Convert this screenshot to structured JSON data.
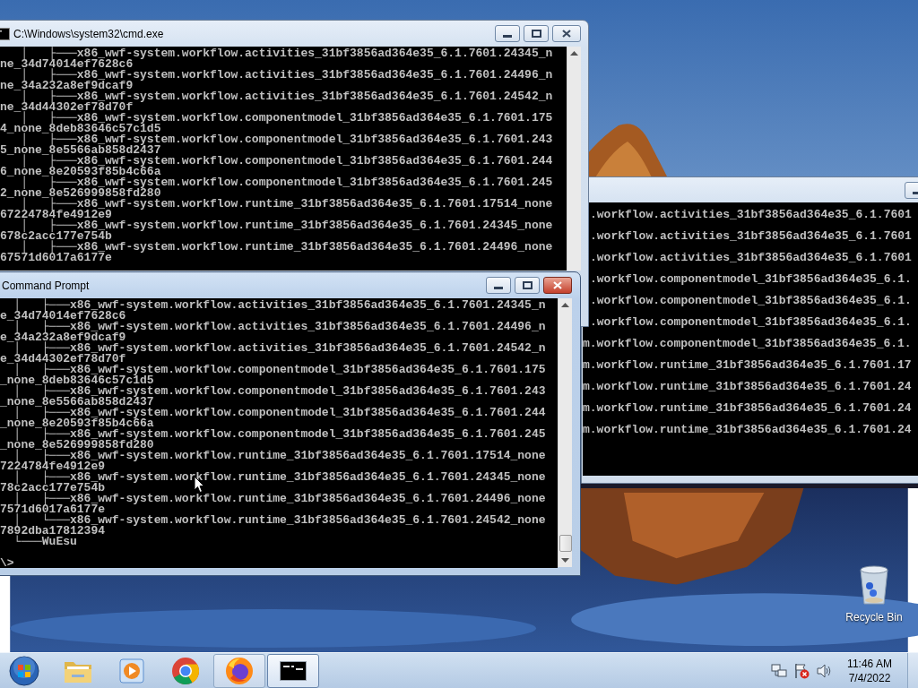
{
  "windows": [
    {
      "title": "C:\\Windows\\system32\\cmd.exe",
      "active": false,
      "lines": [
        "   │   ├───x86_wwf-system.workflow.activities_31bf3856ad364e35_6.1.7601.24345_n",
        "ne_34d74014ef7628c6",
        "   │   ├───x86_wwf-system.workflow.activities_31bf3856ad364e35_6.1.7601.24496_n",
        "ne_34a232a8ef9dcaf9",
        "   │   ├───x86_wwf-system.workflow.activities_31bf3856ad364e35_6.1.7601.24542_n",
        "ne_34d44302ef78d70f",
        "   │   ├───x86_wwf-system.workflow.componentmodel_31bf3856ad364e35_6.1.7601.175",
        "4_none_8deb83646c57c1d5",
        "   │   ├───x86_wwf-system.workflow.componentmodel_31bf3856ad364e35_6.1.7601.243",
        "5_none_8e5566ab858d2437",
        "   │   ├───x86_wwf-system.workflow.componentmodel_31bf3856ad364e35_6.1.7601.244",
        "6_none_8e20593f85b4c66a",
        "   │   ├───x86_wwf-system.workflow.componentmodel_31bf3856ad364e35_6.1.7601.245",
        "2_none_8e526999858fd280",
        "   │   ├───x86_wwf-system.workflow.runtime_31bf3856ad364e35_6.1.7601.17514_none",
        "67224784fe4912e9",
        "   │   ├───x86_wwf-system.workflow.runtime_31bf3856ad364e35_6.1.7601.24345_none",
        "678c2acc177e754b",
        "   │   ├───x86_wwf-system.workflow.runtime_31bf3856ad364e35_6.1.7601.24496_none",
        "67571d6017a6177e"
      ]
    },
    {
      "active": false,
      "lines": [
        ".workflow.activities_31bf3856ad364e35_6.1.7601",
        ".workflow.activities_31bf3856ad364e35_6.1.7601",
        ".workflow.activities_31bf3856ad364e35_6.1.7601",
        ".workflow.componentmodel_31bf3856ad364e35_6.1.",
        ".workflow.componentmodel_31bf3856ad364e35_6.1.",
        ".workflow.componentmodel_31bf3856ad364e35_6.1.",
        "m.workflow.componentmodel_31bf3856ad364e35_6.1.",
        "m.workflow.runtime_31bf3856ad364e35_6.1.7601.17",
        "m.workflow.runtime_31bf3856ad364e35_6.1.7601.24",
        "m.workflow.runtime_31bf3856ad364e35_6.1.7601.24",
        "m.workflow.runtime_31bf3856ad364e35_6.1.7601.24"
      ]
    },
    {
      "title": "Command Prompt",
      "active": true,
      "lines": [
        "  │   ├───x86_wwf-system.workflow.activities_31bf3856ad364e35_6.1.7601.24345_n",
        "e_34d74014ef7628c6",
        "  │   ├───x86_wwf-system.workflow.activities_31bf3856ad364e35_6.1.7601.24496_n",
        "e_34a232a8ef9dcaf9",
        "  │   ├───x86_wwf-system.workflow.activities_31bf3856ad364e35_6.1.7601.24542_n",
        "e_34d44302ef78d70f",
        "  │   ├───x86_wwf-system.workflow.componentmodel_31bf3856ad364e35_6.1.7601.175",
        "_none_8deb83646c57c1d5",
        "  │   ├───x86_wwf-system.workflow.componentmodel_31bf3856ad364e35_6.1.7601.243",
        "_none_8e5566ab858d2437",
        "  │   ├───x86_wwf-system.workflow.componentmodel_31bf3856ad364e35_6.1.7601.244",
        "_none_8e20593f85b4c66a",
        "  │   ├───x86_wwf-system.workflow.componentmodel_31bf3856ad364e35_6.1.7601.245",
        "_none_8e526999858fd280",
        "  │   ├───x86_wwf-system.workflow.runtime_31bf3856ad364e35_6.1.7601.17514_none",
        "7224784fe4912e9",
        "  │   ├───x86_wwf-system.workflow.runtime_31bf3856ad364e35_6.1.7601.24345_none",
        "78c2acc177e754b",
        "  │   ├───x86_wwf-system.workflow.runtime_31bf3856ad364e35_6.1.7601.24496_none",
        "7571d6017a6177e",
        "  │   └───x86_wwf-system.workflow.runtime_31bf3856ad364e35_6.1.7601.24542_none",
        "7892dba17812394",
        "  └───WuEsu"
      ],
      "prompt": "\\>"
    }
  ],
  "desktop": {
    "kind": "picture",
    "icons": [
      {
        "label": "Recycle Bin"
      }
    ]
  },
  "taskbar": {
    "items": [
      {
        "kind": "folder",
        "open": false,
        "selected": false
      },
      {
        "kind": "media",
        "open": false,
        "selected": false
      },
      {
        "kind": "chrome",
        "open": false,
        "selected": false
      },
      {
        "kind": "firefox",
        "open": true,
        "selected": false
      },
      {
        "kind": "console",
        "open": true,
        "selected": true
      }
    ],
    "clock": {
      "time": "11:46 AM",
      "date": "7/4/2022"
    }
  }
}
